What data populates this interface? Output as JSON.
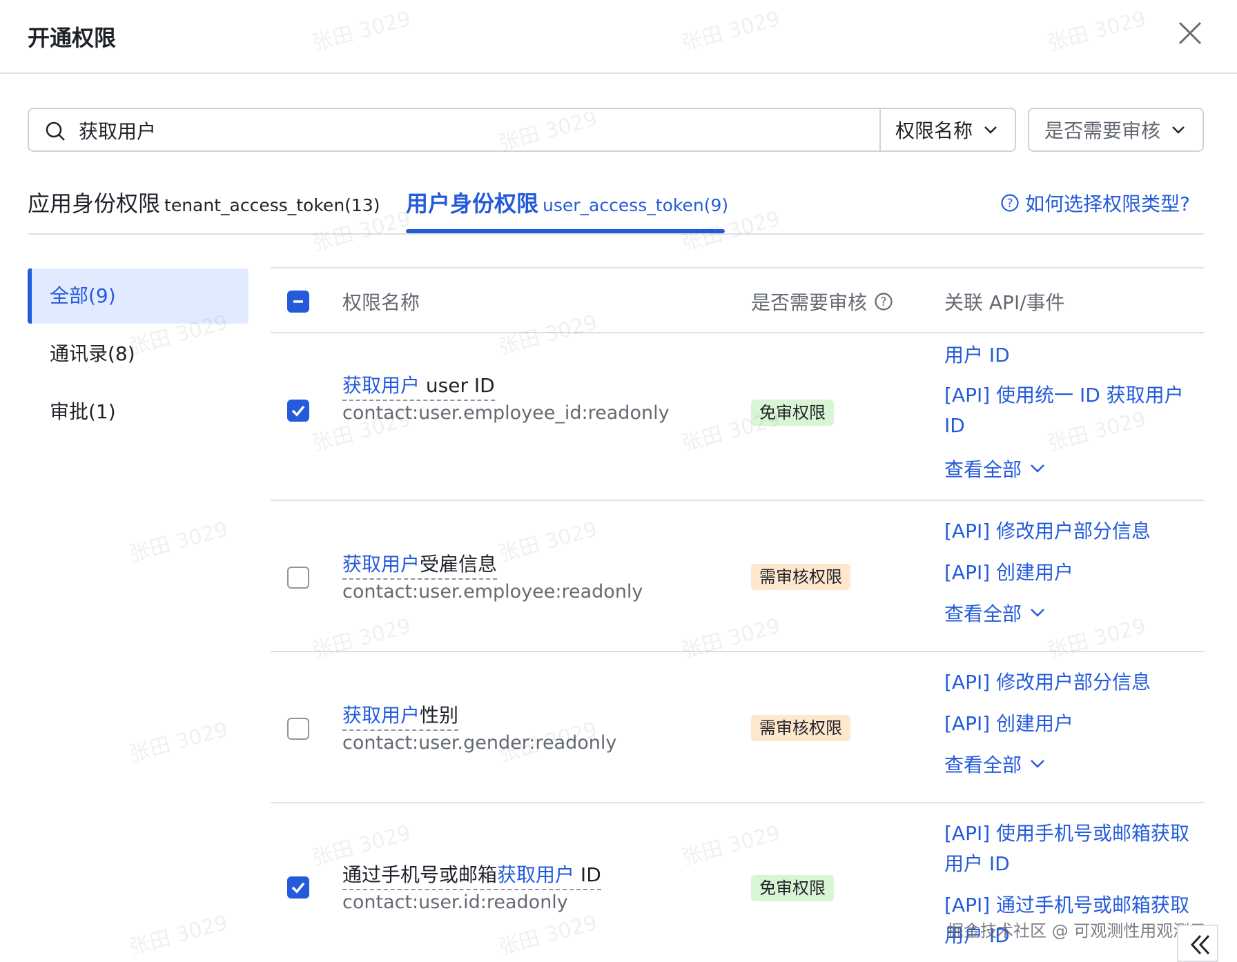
{
  "header": {
    "title": "开通权限"
  },
  "search": {
    "value": "获取用户",
    "field_select": "权限名称",
    "review_select": "是否需要审核"
  },
  "tabs": {
    "tenant": {
      "label": "应用身份权限",
      "sub": "tenant_access_token(13)"
    },
    "user": {
      "label": "用户身份权限",
      "sub": "user_access_token(9)"
    },
    "help": "如何选择权限类型?"
  },
  "sidebar": {
    "items": [
      {
        "label": "全部(9)",
        "active": true
      },
      {
        "label": "通讯录(8)",
        "active": false
      },
      {
        "label": "审批(1)",
        "active": false
      }
    ]
  },
  "table": {
    "headers": {
      "name": "权限名称",
      "review": "是否需要审核",
      "api": "关联 API/事件"
    },
    "rows": [
      {
        "name_highlight": "获取用户",
        "name_rest": " user ID",
        "name_prefix": "",
        "code": "contact:user.employee_id:readonly",
        "badge": "免审权限",
        "checked": true,
        "apis": [
          "用户 ID",
          "[API] 使用统一 ID 获取用户 ID"
        ],
        "view_all": "查看全部"
      },
      {
        "name_highlight": "获取用户",
        "name_rest": "受雇信息",
        "name_prefix": "",
        "code": "contact:user.employee:readonly",
        "badge": "需审核权限",
        "checked": false,
        "apis": [
          "[API] 修改用户部分信息",
          "[API] 创建用户"
        ],
        "view_all": "查看全部"
      },
      {
        "name_highlight": "获取用户",
        "name_rest": "性别",
        "name_prefix": "",
        "code": "contact:user.gender:readonly",
        "badge": "需审核权限",
        "checked": false,
        "apis": [
          "[API] 修改用户部分信息",
          "[API] 创建用户"
        ],
        "view_all": "查看全部"
      },
      {
        "name_prefix": "通过手机号或邮箱",
        "name_highlight": "获取用户",
        "name_rest": " ID",
        "code": "contact:user.id:readonly",
        "badge": "免审权限",
        "checked": true,
        "apis": [
          "[API] 使用手机号或邮箱获取 用户 ID",
          "[API] 通过手机号或邮箱获取 用户 ID"
        ]
      }
    ]
  },
  "watermark_text": "张田 3029",
  "footer_watermark": "掘金技术社区 @ 可观测性用观测云",
  "colors": {
    "accent": "#245bdb",
    "free_badge": "#d9f5d6",
    "review_badge": "#fee7cd"
  }
}
